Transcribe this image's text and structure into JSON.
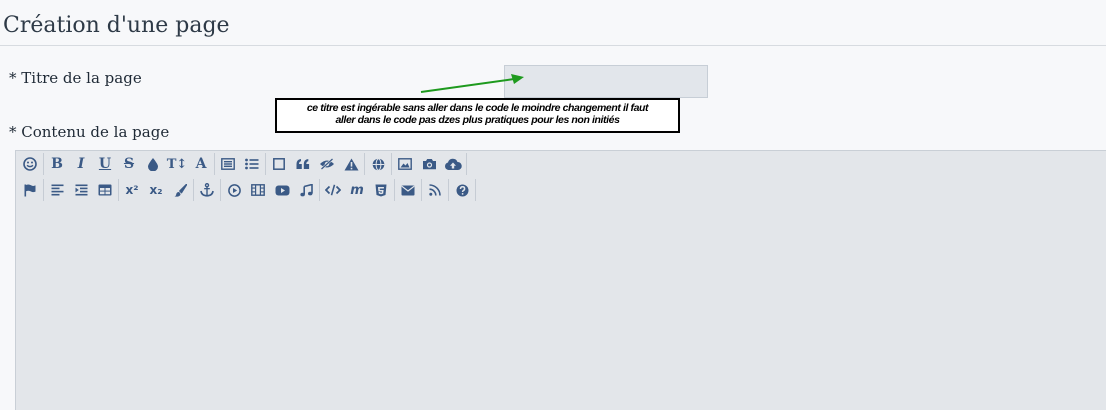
{
  "header": {
    "title": "Création d'une page"
  },
  "form": {
    "title_label": "* Titre de la page",
    "title_value": "",
    "content_label": "* Contenu de la page"
  },
  "annotation": {
    "line1": "ce titre est ingérable sans aller dans le code  le moindre changement il faut",
    "line2": "aller dans le code pas dzes plus pratiques  pour les non initiés",
    "arrow_color": "#1e9a1e"
  },
  "toolbar": {
    "bold": "B",
    "italic": "I",
    "underline": "U",
    "strike": "S",
    "font_size": "T↕",
    "font_family": "A",
    "superscript": "x²",
    "subscript": "x₂",
    "moderation": "m"
  },
  "colors": {
    "icon": "#3b5a86",
    "editor_bg": "#e3e6ea"
  }
}
